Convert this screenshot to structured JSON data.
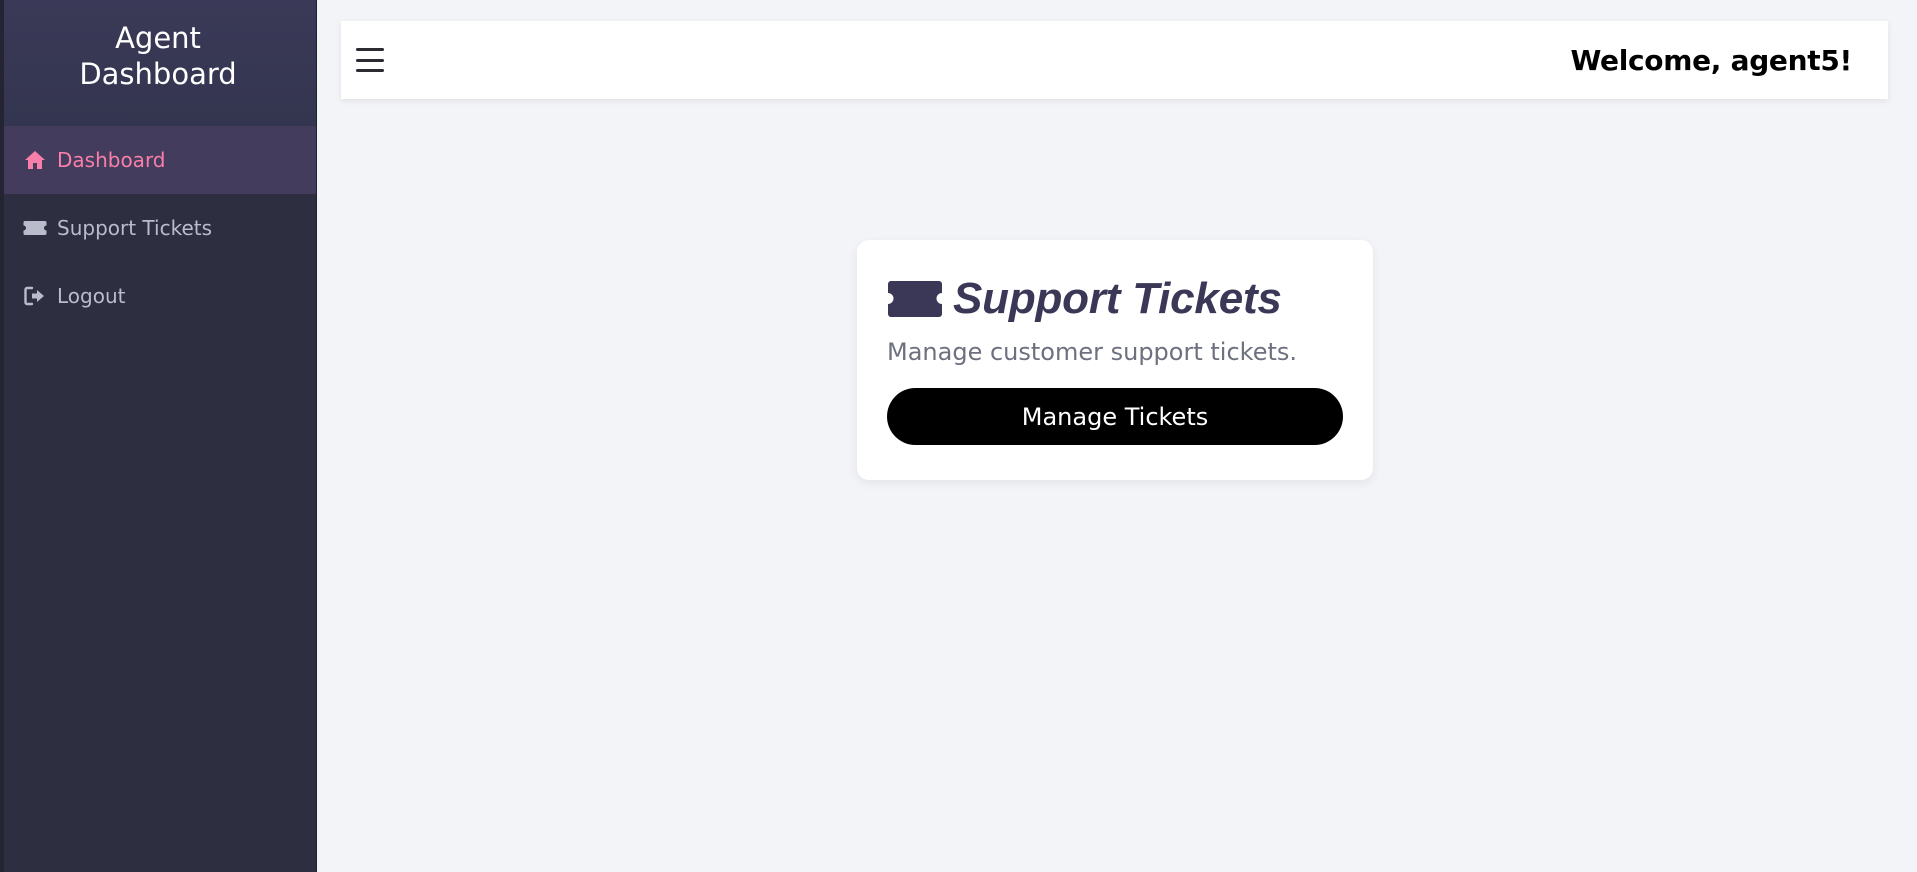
{
  "brand": {
    "line1": "Agent",
    "line2": "Dashboard"
  },
  "sidebar": {
    "items": [
      {
        "label": "Dashboard",
        "icon": "home-icon",
        "active": true
      },
      {
        "label": "Support Tickets",
        "icon": "ticket-icon",
        "active": false
      },
      {
        "label": "Logout",
        "icon": "logout-icon",
        "active": false
      }
    ]
  },
  "header": {
    "menu_icon": "hamburger-icon",
    "welcome": "Welcome, agent5!"
  },
  "card": {
    "icon": "ticket-icon",
    "title": "Support Tickets",
    "description": "Manage customer support tickets.",
    "button_label": "Manage Tickets"
  },
  "colors": {
    "sidebar_bg": "#2d2e40",
    "brand_bg": "#3a3a58",
    "active_item_bg": "#433c5c",
    "active_item_text": "#f87fa9",
    "inactive_item_text": "#b9bccb",
    "page_bg": "#f3f4f8",
    "card_title": "#3a3856",
    "button_bg": "#000000"
  }
}
